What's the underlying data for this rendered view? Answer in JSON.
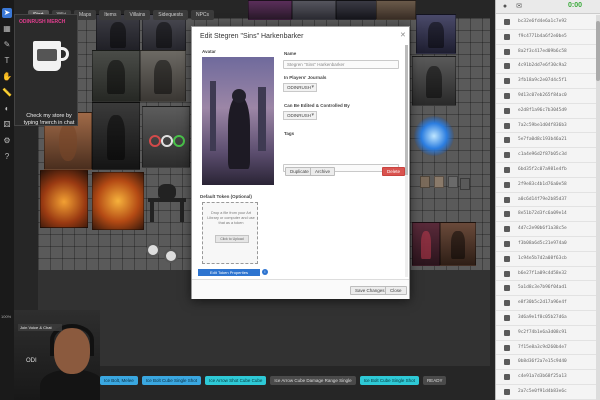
{
  "topbar": {
    "tabs": [
      "Start",
      "Wiki",
      "Maps",
      "Items",
      "Villains",
      "Sidequests",
      "NPCs"
    ],
    "active_index": 0
  },
  "toolbar": {
    "icons": [
      "cursor-icon",
      "map-icon",
      "pencil-icon",
      "text-icon",
      "hand-icon",
      "ruler-icon",
      "fog-icon",
      "dice-icon",
      "settings-icon",
      "help-icon"
    ],
    "zoom_label": "100%"
  },
  "merch": {
    "title": "ODINRUSH MERCH",
    "text": "Check my store by typing !merch in chat",
    "sub": "Powered by Luxx"
  },
  "webcam": {
    "label": "Join Voice & Chat",
    "small": "ODI"
  },
  "macros": [
    {
      "label": "Ice Bolt, Melee",
      "style": "blue"
    },
    {
      "label": "Ice Bolt Cube Single Shot",
      "style": "blue"
    },
    {
      "label": "Ice Arrow Shot Cube Cube",
      "style": "cyan"
    },
    {
      "label": "Ice Arrow Cube Damage Range Single",
      "style": "dark"
    },
    {
      "label": "Ice Bolt Cube Single Shot",
      "style": "cyan"
    },
    {
      "label": "READY",
      "style": "dark"
    }
  ],
  "sidebar": {
    "clock": "0:00",
    "items": [
      "bc32e6fd4e6a1c7e92",
      "f9c4771b4a6f2e0be5",
      "8a2f3c417ed09b6c58",
      "4c91b2dd7e6f30c9a2",
      "3fb18a9c2e07d4c5f1",
      "9d13c07eb265f84ac0",
      "e2d8f1a96c7b3045d9",
      "7a2c59be1d04f836b3",
      "5e7fa0d8c193b46a21",
      "c1a4e96d2f87b05c3d",
      "6bd35f2c07a981e4fb",
      "2f9e83c4b1d76a0e58",
      "a0c6d14f79e2b85d37",
      "8e51b72d3fc6a09e14",
      "4d7c2e90b6f1a38c5e",
      "f3b08a6d5c21e974a0",
      "1c94e5b7d2a08f63cb",
      "b6e27f1a09c4d58e32",
      "5a1d8c3e7b96f04ad1",
      "e8f30b5c2d17a96e4f",
      "3d6a9e1f8c05b27d6a",
      "9c2f74b1e6a3d08c91",
      "7f15e8a3c9d260b4e7",
      "0b8d36f2a7e15c9d40",
      "c4e91a7d3b68f25a13",
      "2a7c5e0f91d4b83e6c"
    ]
  },
  "dialog": {
    "title": "Edit Stegren \"Sins\" Harkenbarker",
    "avatar_label": "Avatar",
    "name_label": "Name",
    "name_value": "Stegren \"Sins\" Harkenbarker",
    "journals_label": "In Players' Journals",
    "journals_value": "ODINRUSH",
    "control_label": "Can Be Edited & Controlled By",
    "control_value": "ODINRUSH",
    "tags_label": "Tags",
    "duplicate_label": "Duplicate",
    "archive_label": "Archive",
    "delete_label": "Delete",
    "default_token_label": "Default Token (Optional)",
    "upload_text": "Drop a file from your Art Library or computer and use that as a token",
    "upload_button": "Click to Upload",
    "edit_props_label": "Edit Token Properties",
    "save_label": "Save Changes",
    "close_label": "Close"
  },
  "colors": {
    "accent_blue": "#2d74d0",
    "delete_red": "#d9534f",
    "merch_pink": "#e23e8f",
    "clock_green": "#3aaa3a"
  }
}
